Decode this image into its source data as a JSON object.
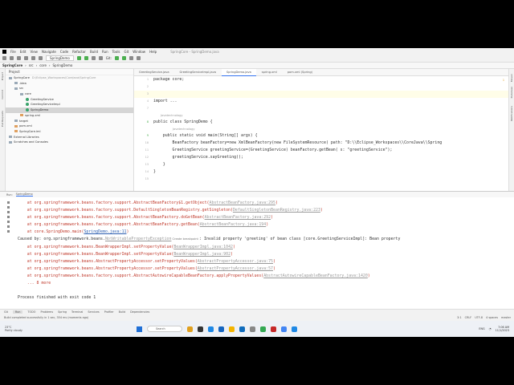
{
  "window": {
    "title": "SpringCore - SpringDemo.java"
  },
  "menu": [
    "File",
    "Edit",
    "View",
    "Navigate",
    "Code",
    "Refactor",
    "Build",
    "Run",
    "Tools",
    "Git",
    "Window",
    "Help"
  ],
  "toolbar": {
    "run_config": "SpringDemo",
    "git_label": "Git:"
  },
  "breadcrumb": [
    "SpringCore",
    "src",
    "core",
    "SpringDemo"
  ],
  "left_strip": [
    "Project",
    "Commit",
    "Pull Requests"
  ],
  "right_strip": [
    "Maven",
    "Database",
    "Notifications"
  ],
  "project": {
    "header": "Project",
    "tree": [
      {
        "label": "SpringCore",
        "extra": "D:\\Eclipse_Workspaces\\CoreJava\\SpringCore",
        "indent": 0,
        "type": "folder"
      },
      {
        "label": ".idea",
        "indent": 1,
        "type": "folder"
      },
      {
        "label": "src",
        "indent": 1,
        "type": "folder"
      },
      {
        "label": "core",
        "indent": 2,
        "type": "folder"
      },
      {
        "label": "GreetingService",
        "indent": 3,
        "type": "class"
      },
      {
        "label": "GreetingServiceImpl",
        "indent": 3,
        "type": "class"
      },
      {
        "label": "SpringDemo",
        "indent": 3,
        "type": "class",
        "selected": true
      },
      {
        "label": "spring.xml",
        "indent": 2,
        "type": "file"
      },
      {
        "label": "target",
        "indent": 1,
        "type": "folder"
      },
      {
        "label": "pom.xml",
        "indent": 1,
        "type": "file"
      },
      {
        "label": "SpringCore.iml",
        "indent": 1,
        "type": "file"
      },
      {
        "label": "External Libraries",
        "indent": 0,
        "type": "folder"
      },
      {
        "label": "Scratches and Consoles",
        "indent": 0,
        "type": "folder"
      }
    ]
  },
  "editor": {
    "tabs": [
      "GreetingService.java",
      "GreetingServiceImpl.java",
      "SpringDemo.java",
      "spring.xml",
      "pom.xml (Spring)"
    ],
    "active_tab": 2,
    "hint_author": "Javatechnology",
    "warning_count": "1",
    "lines": [
      {
        "n": "1",
        "text": "package core;"
      },
      {
        "n": "2",
        "text": ""
      },
      {
        "n": "3",
        "text": "",
        "current": true
      },
      {
        "n": "4",
        "text": "import ..."
      },
      {
        "n": "7",
        "text": ""
      },
      {
        "hint": "Javatechnology"
      },
      {
        "n": "8",
        "text": "public class SpringDemo {",
        "run": true
      },
      {
        "hint": "Javatechnology",
        "indent": 1
      },
      {
        "n": "9",
        "text": "    public static void main(String[] args) {",
        "run": true
      },
      {
        "n": "10",
        "text": "        BeanFactory beanFactory=new XmlBeanFactory(new FileSystemResource( path: \"D:\\\\Eclipse_Workspaces\\\\CoreJava\\\\Spring"
      },
      {
        "n": "11",
        "text": "        GreetingService greetingService=(GreetingService) beanFactory.getBean( s: \"greetingService\");"
      },
      {
        "n": "12",
        "text": "        greetingService.sayGreeting();"
      },
      {
        "n": "13",
        "text": "    }"
      },
      {
        "n": "14",
        "text": "}"
      },
      {
        "n": "15",
        "text": ""
      }
    ]
  },
  "run": {
    "label": "Run:",
    "tab": "SpringDemo",
    "console": [
      {
        "pre": "    at org.springframework.beans.factory.support.AbstractBeanFactory$1.getObject(",
        "link": "AbstractBeanFactory.java:295",
        "post": ")"
      },
      {
        "pre": "    at org.springframework.beans.factory.support.DefaultSingletonBeanRegistry.getSingleton(",
        "link": "DefaultSingletonBeanRegistry.java:223",
        "post": ")"
      },
      {
        "pre": "    at org.springframework.beans.factory.support.AbstractBeanFactory.doGetBean(",
        "link": "AbstractBeanFactory.java:292",
        "post": ")"
      },
      {
        "pre": "    at org.springframework.beans.factory.support.AbstractBeanFactory.getBean(",
        "link": "AbstractBeanFactory.java:194",
        "post": ")"
      },
      {
        "pre": "    at core.SpringDemo.main(",
        "link": "SpringDemo.java:11",
        "post": ")",
        "blue": true
      },
      {
        "pre": "Caused by: org.springframework.beans.",
        "link": "NotWritablePropertyException",
        "mid": " Create breakpoint ",
        "post": ": Invalid property 'greeting' of bean class [core.GreetingServiceImpl]: Bean property"
      },
      {
        "pre": "    at org.springframework.beans.BeanWrapperImpl.setPropertyValue(",
        "link": "BeanWrapperImpl.java:1042",
        "post": ")"
      },
      {
        "pre": "    at org.springframework.beans.BeanWrapperImpl.setPropertyValue(",
        "link": "BeanWrapperImpl.java:902",
        "post": ")"
      },
      {
        "pre": "    at org.springframework.beans.AbstractPropertyAccessor.setPropertyValues(",
        "link": "AbstractPropertyAccessor.java:75",
        "post": ")"
      },
      {
        "pre": "    at org.springframework.beans.AbstractPropertyAccessor.setPropertyValues(",
        "link": "AbstractPropertyAccessor.java:57",
        "post": ")"
      },
      {
        "pre": "    at org.springframework.beans.factory.support.AbstractAutowireCapableBeanFactory.applyPropertyValues(",
        "link": "AbstractAutowireCapableBeanFactory.java:1420",
        "post": ")"
      },
      {
        "pre": "    ... 8 more"
      },
      {
        "pre": ""
      },
      {
        "pre": "Process finished with exit code 1"
      }
    ]
  },
  "bottom_tabs": [
    "Git",
    "Run",
    "TODO",
    "Problems",
    "Spring",
    "Terminal",
    "Services",
    "Profiler",
    "Build",
    "Dependencies"
  ],
  "status": {
    "message": "Build completed successfully in 1 sec, 354 ms (moments ago)",
    "position": "3:1",
    "line_sep": "CRLF",
    "encoding": "UTF-8",
    "indent": "4 spaces",
    "branch": "master"
  },
  "taskbar": {
    "temp": "23°C",
    "weather": "Partly cloudy",
    "search": "Search",
    "lang": "ENG",
    "time": "7:06 AM",
    "date": "11/1/2023",
    "app_colors": [
      "#e0a020",
      "#333333",
      "#1e88e5",
      "#1565c0",
      "#f4b400",
      "#0f6cbd",
      "#888888",
      "#34a853",
      "#c62828",
      "#4285f4",
      "#1e88e5"
    ]
  }
}
